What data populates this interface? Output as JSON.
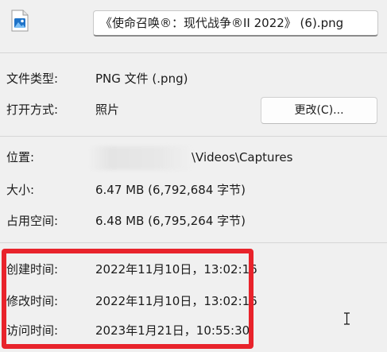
{
  "file": {
    "name": "《使命召唤®：现代战争®II 2022》 (6).png",
    "icon": "image-file-icon"
  },
  "properties": {
    "file_type": {
      "label": "文件类型:",
      "value": "PNG 文件 (.png)"
    },
    "opens_with": {
      "label": "打开方式:",
      "value": "照片",
      "change_button": "更改(C)..."
    },
    "location": {
      "label": "位置:",
      "value": "\\Videos\\Captures"
    },
    "size": {
      "label": "大小:",
      "value": "6.47 MB (6,792,684 字节)"
    },
    "size_on_disk": {
      "label": "占用空间:",
      "value": "6.48 MB (6,795,264 字节)"
    },
    "created": {
      "label": "创建时间:",
      "value": "2022年11月10日，13:02:16"
    },
    "modified": {
      "label": "修改时间:",
      "value": "2022年11月10日，13:02:16"
    },
    "accessed": {
      "label": "访问时间:",
      "value": "2023年1月21日，10:55:30"
    }
  },
  "colors": {
    "highlight": "#e8232b",
    "icon_blue": "#1e73c8"
  }
}
